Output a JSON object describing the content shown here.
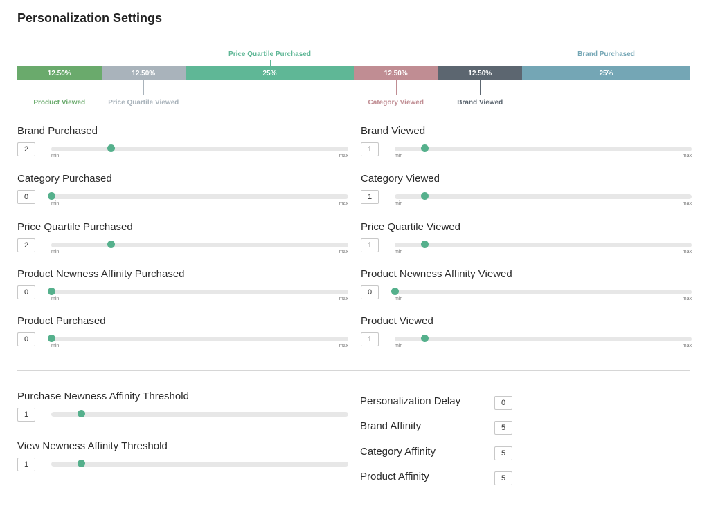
{
  "title": "Personalization Settings",
  "distribution": {
    "segments": [
      {
        "label": "Product Viewed",
        "value": "12.50%",
        "color": "#6aaa6c"
      },
      {
        "label": "Price Quartile Viewed",
        "value": "12.50%",
        "color": "#a9b3bb"
      },
      {
        "label": "Price Quartile Purchased",
        "value": "25%",
        "color": "#5fb796"
      },
      {
        "label": "Category Viewed",
        "value": "12.50%",
        "color": "#c08d93"
      },
      {
        "label": "Brand Viewed",
        "value": "12.50%",
        "color": "#5c6670"
      },
      {
        "label": "Brand Purchased",
        "value": "25%",
        "color": "#74a6b5"
      }
    ]
  },
  "sliders": {
    "min_label": "min",
    "max_label": "max",
    "left": [
      {
        "label": "Brand Purchased",
        "value": "2",
        "level": 0.2
      },
      {
        "label": "Category Purchased",
        "value": "0",
        "level": 0.0
      },
      {
        "label": "Price Quartile Purchased",
        "value": "2",
        "level": 0.2
      },
      {
        "label": "Product Newness Affinity Purchased",
        "value": "0",
        "level": 0.0
      },
      {
        "label": "Product Purchased",
        "value": "0",
        "level": 0.0
      }
    ],
    "right": [
      {
        "label": "Brand Viewed",
        "value": "1",
        "level": 0.1
      },
      {
        "label": "Category Viewed",
        "value": "1",
        "level": 0.1
      },
      {
        "label": "Price Quartile Viewed",
        "value": "1",
        "level": 0.1
      },
      {
        "label": "Product Newness Affinity Viewed",
        "value": "0",
        "level": 0.0
      },
      {
        "label": "Product Viewed",
        "value": "1",
        "level": 0.1
      }
    ]
  },
  "thresholds": [
    {
      "label": "Purchase Newness Affinity Threshold",
      "value": "1",
      "level": 0.1
    },
    {
      "label": "View Newness Affinity Threshold",
      "value": "1",
      "level": 0.1
    }
  ],
  "affinities": [
    {
      "label": "Personalization Delay",
      "value": "0"
    },
    {
      "label": "Brand Affinity",
      "value": "5"
    },
    {
      "label": "Category Affinity",
      "value": "5"
    },
    {
      "label": "Product Affinity",
      "value": "5"
    }
  ]
}
